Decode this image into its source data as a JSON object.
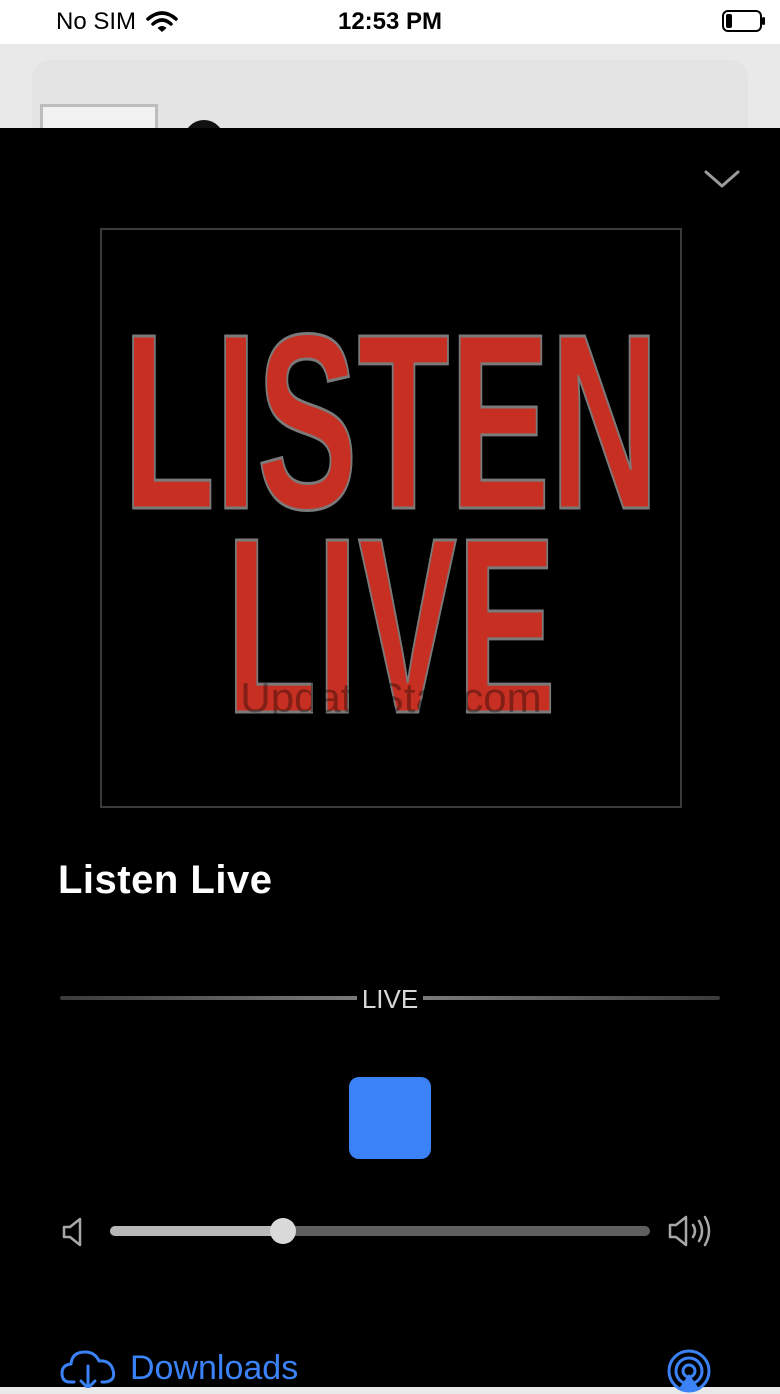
{
  "status_bar": {
    "carrier": "No SIM",
    "time": "12:53 PM"
  },
  "player": {
    "artwork_text_line1": "LISTEN",
    "artwork_text_line2": "LIVE",
    "watermark": "UpdateStar.com",
    "title": "Listen Live",
    "progress_label": "LIVE",
    "volume_level": 0.32,
    "downloads_label": "Downloads"
  },
  "colors": {
    "accent": "#3b82f6",
    "artwork_red": "#c62f22",
    "sheet_bg": "#000000"
  },
  "icons": {
    "collapse": "chevron-down-icon",
    "volume_low": "speaker-low-icon",
    "volume_high": "speaker-high-icon",
    "downloads": "cloud-download-icon",
    "airplay": "airplay-icon",
    "wifi": "wifi-icon",
    "battery": "battery-icon"
  }
}
